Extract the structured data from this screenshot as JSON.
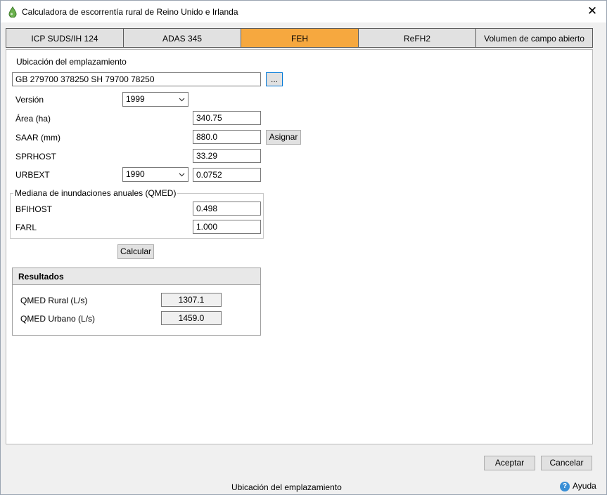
{
  "window": {
    "title": "Calculadora de escorrentía rural de Reino Unido e Irlanda",
    "close_glyph": "✕"
  },
  "tabs": [
    {
      "label": "ICP SUDS/IH 124"
    },
    {
      "label": "ADAS 345"
    },
    {
      "label": "FEH"
    },
    {
      "label": "ReFH2"
    },
    {
      "label": "Volumen de campo abierto"
    }
  ],
  "active_tab": "FEH",
  "form": {
    "site_location_label": "Ubicación del emplazamiento",
    "site_location_value": "GB 279700 378250 SH 79700 78250",
    "browse_label": "...",
    "version_label": "Versión",
    "version_value": "1999",
    "area_label": "Área (ha)",
    "area_value": "340.75",
    "saar_label": "SAAR (mm)",
    "saar_value": "880.0",
    "assign_label": "Asignar",
    "sprhost_label": "SPRHOST",
    "sprhost_value": "33.29",
    "urbext_label": "URBEXT",
    "urbext_year": "1990",
    "urbext_value": "0.0752",
    "qmed_group_label": "Mediana de inundaciones anuales (QMED)",
    "bfihost_label": "BFIHOST",
    "bfihost_value": "0.498",
    "farl_label": "FARL",
    "farl_value": "1.000",
    "calculate_label": "Calcular"
  },
  "results": {
    "title": "Resultados",
    "qmed_rural_label": "QMED Rural (L/s)",
    "qmed_rural_value": "1307.1",
    "qmed_urban_label": "QMED Urbano (L/s)",
    "qmed_urban_value": "1459.0"
  },
  "footer": {
    "ok_label": "Aceptar",
    "cancel_label": "Cancelar",
    "status_text": "Ubicación del emplazamiento",
    "help_label": "Ayuda"
  },
  "colors": {
    "active_tab": "#f6a83f",
    "focus_border": "#0078d7",
    "app_icon": "#6ab04c"
  }
}
